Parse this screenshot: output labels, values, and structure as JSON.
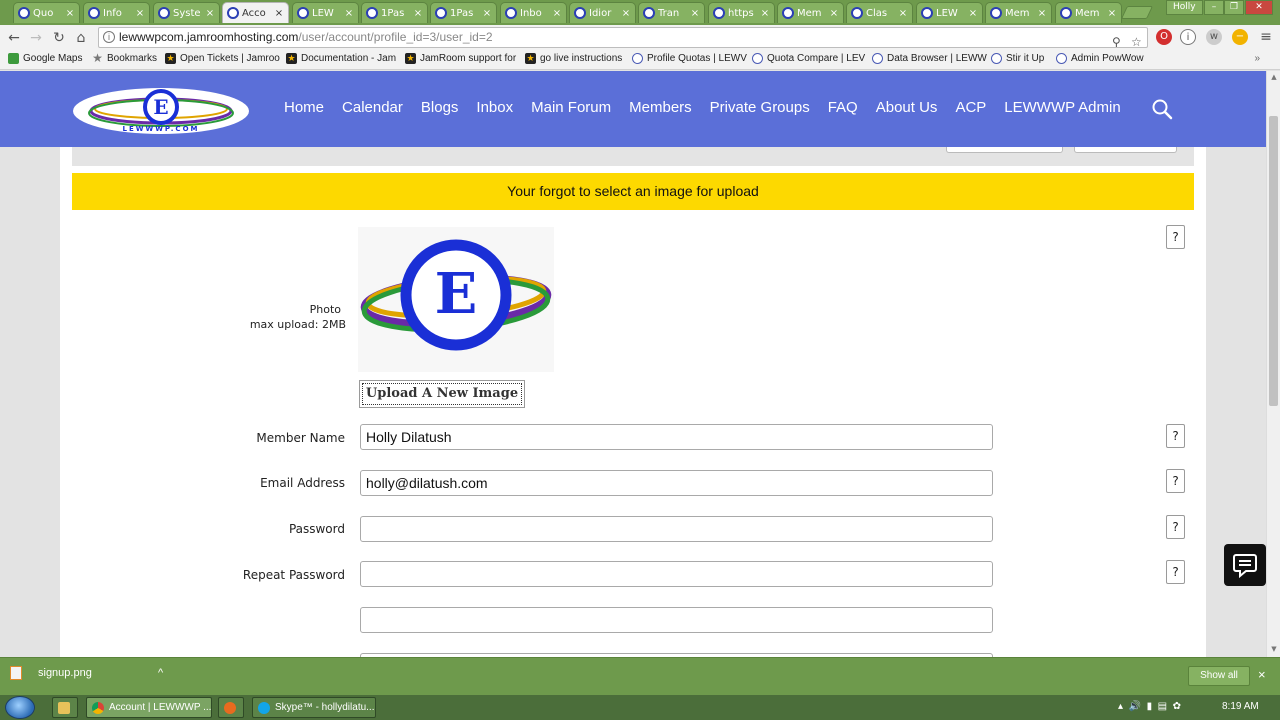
{
  "browser": {
    "tabs": [
      {
        "label": "Quo"
      },
      {
        "label": "Info"
      },
      {
        "label": "Syste"
      },
      {
        "label": "Acco"
      },
      {
        "label": "LEW"
      },
      {
        "label": "1Pas"
      },
      {
        "label": "1Pas"
      },
      {
        "label": "Inbo"
      },
      {
        "label": "Idior"
      },
      {
        "label": "Tran"
      },
      {
        "label": "https"
      },
      {
        "label": "Mem"
      },
      {
        "label": "Clas"
      },
      {
        "label": "LEW"
      },
      {
        "label": "Mem"
      },
      {
        "label": "Mem"
      }
    ],
    "tab_close_glyph": "×",
    "profile_name": "Holly",
    "url_host": "lewwwpcom.jamroomhosting.com",
    "url_path": "/user/account/profile_id=3/user_id=2",
    "bookmarks": [
      {
        "label": "Google Maps",
        "icon": "map-icon"
      },
      {
        "label": "Bookmarks",
        "icon": "star-icon"
      },
      {
        "label": "Open Tickets | Jamroo",
        "icon": "jamroom-icon"
      },
      {
        "label": "Documentation - Jam",
        "icon": "jamroom-icon"
      },
      {
        "label": "JamRoom support for",
        "icon": "jamroom-icon"
      },
      {
        "label": "go live instructions",
        "icon": "jamroom-icon"
      },
      {
        "label": "Profile Quotas | LEWV",
        "icon": "lewwwp-icon"
      },
      {
        "label": "Quota Compare | LEV",
        "icon": "lewwwp-icon"
      },
      {
        "label": "Data Browser | LEWW",
        "icon": "lewwwp-icon"
      },
      {
        "label": "Stir it Up",
        "icon": "lewwwp-icon"
      },
      {
        "label": "Admin PowWow",
        "icon": "lewwwp-icon"
      }
    ],
    "bookmarks_more": "»"
  },
  "site": {
    "logo_text": "LEWWWP.COM",
    "logo_letter": "E",
    "nav": [
      "Home",
      "Calendar",
      "Blogs",
      "Inbox",
      "Main Forum",
      "Members",
      "Private Groups",
      "FAQ",
      "About Us",
      "ACP",
      "LEWWWP Admin"
    ],
    "brand_color": "#5b6fd8",
    "alert_color": "#fdd900"
  },
  "page": {
    "alert": "Your forgot to select an image for upload",
    "help_glyph": "?",
    "photo_label": "Photo",
    "photo_sublabel": "max upload: 2MB",
    "upload_button": "Upload A New Image",
    "fields": {
      "member_name": {
        "label": "Member Name",
        "value": "Holly Dilatush"
      },
      "email": {
        "label": "Email Address",
        "value": "holly@dilatush.com"
      },
      "password": {
        "label": "Password",
        "value": ""
      },
      "repeat_password": {
        "label": "Repeat Password",
        "value": ""
      }
    }
  },
  "downloads": {
    "file": "signup.png",
    "chevron": "^",
    "show_all": "Show all",
    "close": "×"
  },
  "taskbar": {
    "items": [
      {
        "label": "Account | LEWWWP ..."
      },
      {
        "label": "Skype™ - hollydilatu..."
      }
    ],
    "clock": "8:19 AM"
  }
}
